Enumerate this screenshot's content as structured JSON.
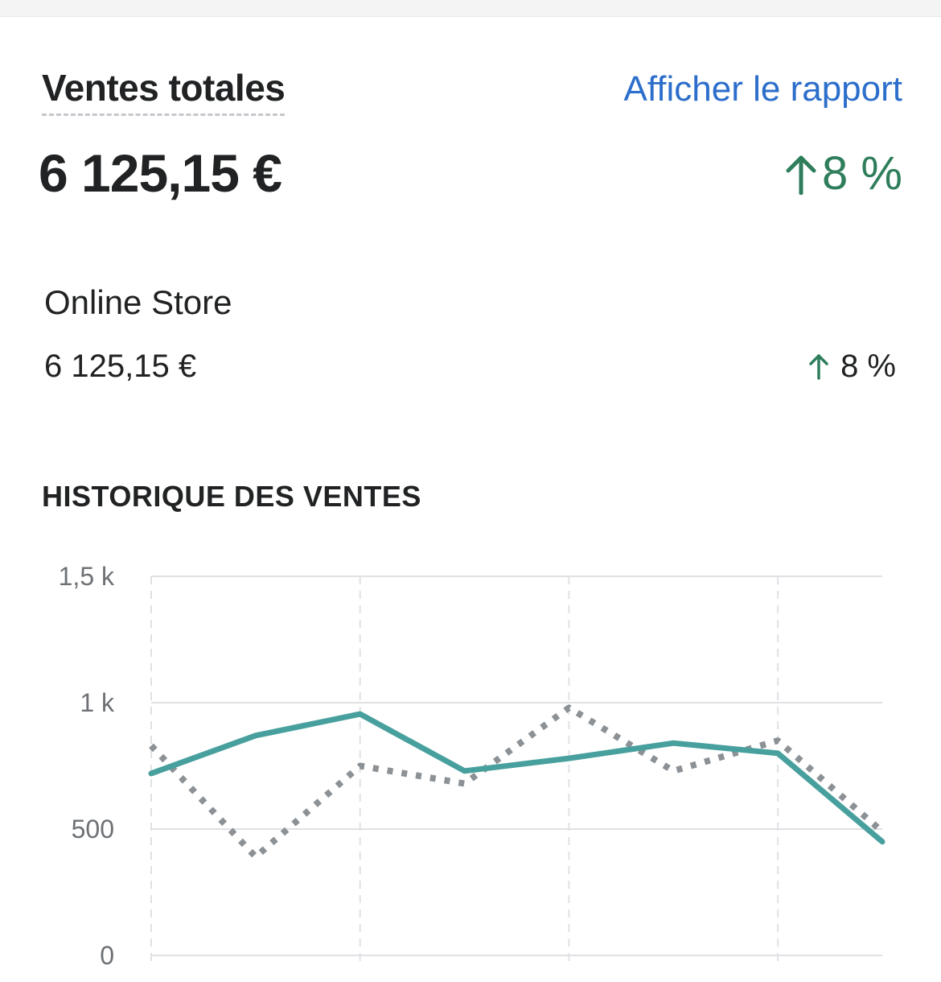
{
  "card": {
    "title": "Ventes totales",
    "report_link": "Afficher le rapport",
    "total_amount": "6 125,15 €",
    "total_change": "8 %",
    "total_change_icon": "arrow-up-icon",
    "positive_color": "#2e7d5b",
    "link_color": "#2c6ecb"
  },
  "channel": {
    "name": "Online Store",
    "amount": "6 125,15 €",
    "change": "8 %",
    "change_icon": "arrow-up-icon"
  },
  "history": {
    "title": "HISTORIQUE DES VENTES"
  },
  "chart_data": {
    "type": "line",
    "y_ticks": [
      "0",
      "500",
      "1 k",
      "1,5 k"
    ],
    "ylim": [
      0,
      1500
    ],
    "grid": true,
    "x": [
      0,
      1,
      2,
      3,
      4,
      5,
      6,
      7
    ],
    "series": [
      {
        "style": "solid",
        "color": "#47a09d",
        "values": [
          720,
          870,
          955,
          730,
          780,
          840,
          800,
          450
        ]
      },
      {
        "style": "dotted",
        "color": "#8c9196",
        "values": [
          830,
          390,
          750,
          680,
          980,
          730,
          850,
          490
        ]
      }
    ]
  }
}
